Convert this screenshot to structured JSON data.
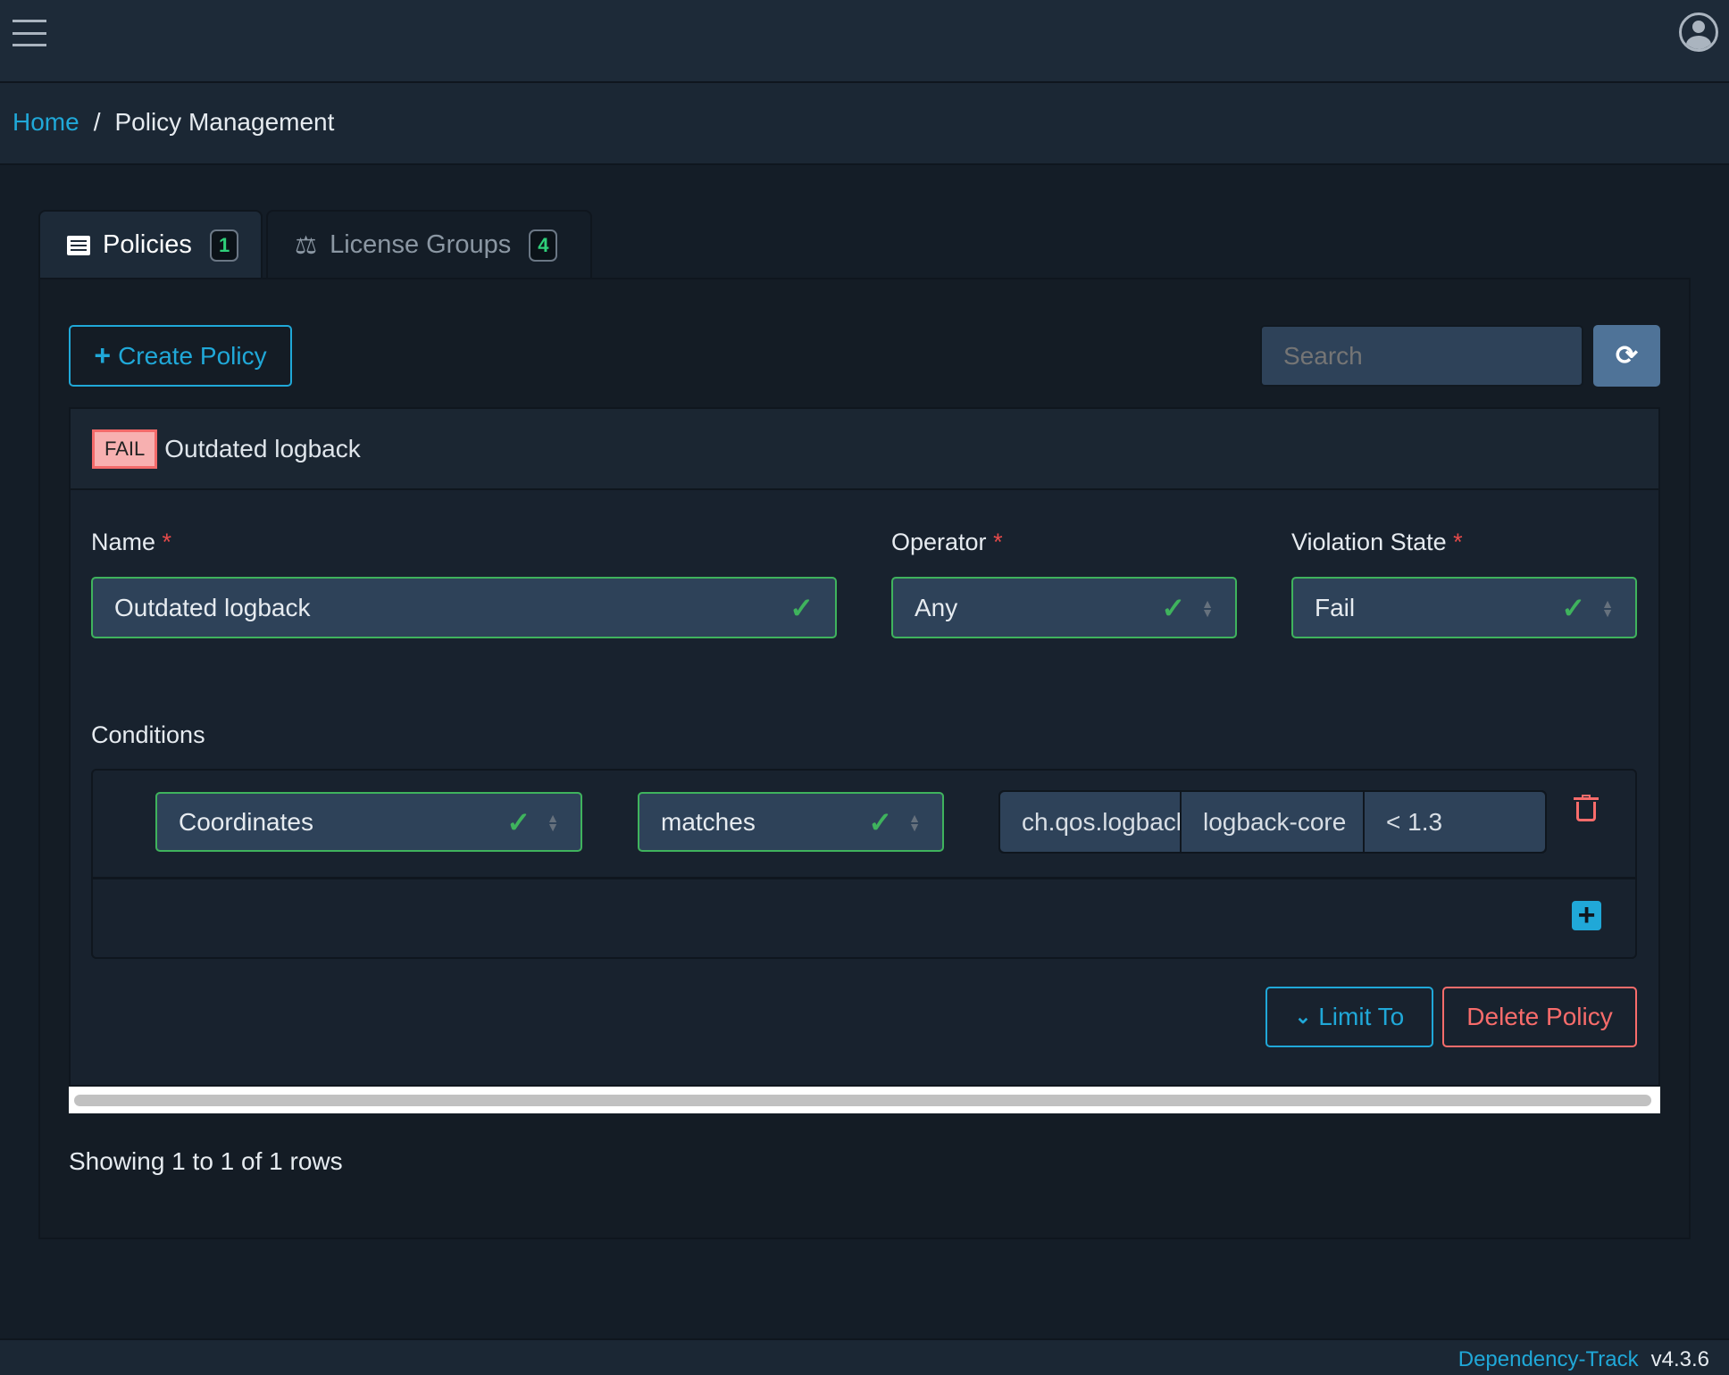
{
  "breadcrumb": {
    "home": "Home",
    "separator": "/",
    "current": "Policy Management"
  },
  "tabs": [
    {
      "label": "Policies",
      "count": "1"
    },
    {
      "label": "License Groups",
      "count": "4"
    }
  ],
  "toolbar": {
    "create_label": "Create Policy",
    "search_placeholder": "Search"
  },
  "policy": {
    "badge": "FAIL",
    "title": "Outdated logback",
    "name_label": "Name",
    "name_value": "Outdated logback",
    "operator_label": "Operator",
    "operator_value": "Any",
    "violation_label": "Violation State",
    "violation_value": "Fail",
    "required_mark": "*",
    "conditions_label": "Conditions",
    "conditions": [
      {
        "subject": "Coordinates",
        "operator": "matches",
        "group": "ch.qos.logback",
        "name": "logback-core",
        "version": "< 1.3"
      }
    ],
    "limit_label": "Limit To",
    "delete_label": "Delete Policy"
  },
  "pagination": {
    "summary": "Showing 1 to 1 of 1 rows"
  },
  "footer": {
    "app": "Dependency-Track",
    "version": "v4.3.6"
  },
  "colors": {
    "accent": "#20a8d8",
    "danger": "#f86c6b",
    "success": "#3fb35d"
  }
}
